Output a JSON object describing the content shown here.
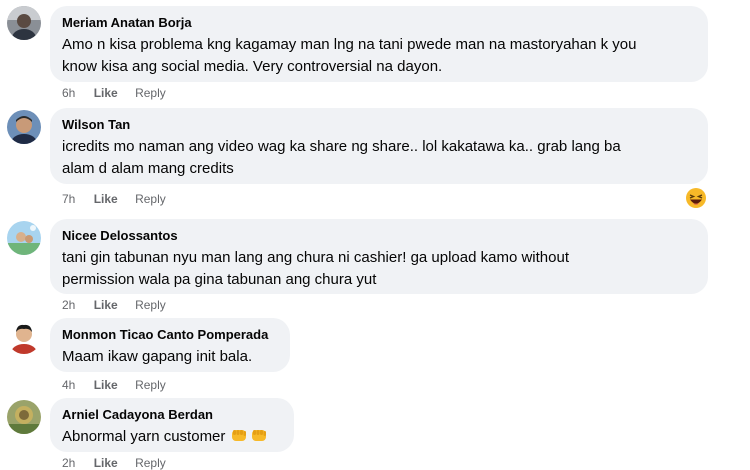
{
  "comments": [
    {
      "author": "Meriam Anatan Borja",
      "text_line1": "Amo n kisa problema kng kagamay man lng na tani pwede man na mastoryahan k you",
      "text_line2": "know kisa ang social media. Very controversial na dayon.",
      "time": "6h",
      "like": "Like",
      "reply": "Reply"
    },
    {
      "author": "Wilson Tan",
      "text_line1": "icredits mo naman ang video wag ka share ng share.. lol kakatawa ka.. grab lang ba",
      "text_line2": "alam d alam mang credits",
      "time": "7h",
      "like": "Like",
      "reply": "Reply",
      "reaction_icon": "laughing-emoji-icon"
    },
    {
      "author": "Nicee Delossantos",
      "text_line1": "tani gin tabunan nyu man lang ang chura ni cashier! ga upload kamo without",
      "text_line2": "permission wala pa gina tabunan ang chura yut",
      "time": "2h",
      "like": "Like",
      "reply": "Reply"
    },
    {
      "author": "Monmon Ticao Canto Pomperada",
      "text_line1": "Maam ikaw gapang init bala.",
      "time": "4h",
      "like": "Like",
      "reply": "Reply"
    },
    {
      "author": "Arniel Cadayona Berdan",
      "text_line1": "Abnormal yarn customer",
      "text_emoji": "oncoming-fist-emoji-icon",
      "time": "2h",
      "like": "Like",
      "reply": "Reply"
    }
  ],
  "colors": {
    "bubble_bg": "#f0f2f5",
    "meta_text": "#65676b",
    "main_text": "#050505"
  }
}
